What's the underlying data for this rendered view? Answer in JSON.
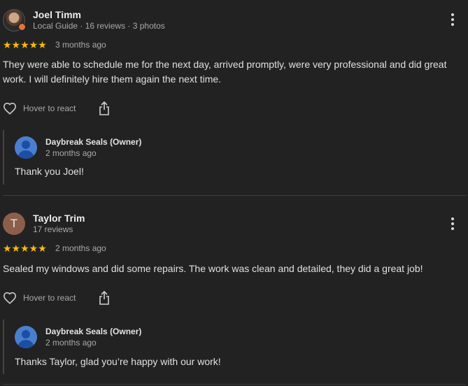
{
  "reviews": [
    {
      "reviewer": "Joel Timm",
      "meta": "Local Guide · 16 reviews · 3 photos",
      "stars": "★★★★★",
      "rating": 5,
      "date": "3 months ago",
      "text": "They were able to schedule me for the next day, arrived promptly, were very professional and did great work. I will definitely hire them again the next time.",
      "react_label": "Hover to react",
      "reply": {
        "owner": "Daybreak Seals (Owner)",
        "date": "2 months ago",
        "text": "Thank you Joel!"
      }
    },
    {
      "reviewer": "Taylor Trim",
      "avatar_letter": "T",
      "meta": "17 reviews",
      "stars": "★★★★★",
      "rating": 5,
      "date": "2 months ago",
      "text": "Sealed my windows and did some repairs. The work was clean and detailed, they did a great job!",
      "react_label": "Hover to react",
      "reply": {
        "owner": "Daybreak Seals (Owner)",
        "date": "2 months ago",
        "text": "Thanks Taylor, glad you’re happy with our work!"
      }
    }
  ],
  "colors": {
    "background": "#222222",
    "star": "#fbbc04",
    "avatar_letter_bg": "#8d5e4c",
    "owner_avatar_bg": "#4a7fd0"
  },
  "icons": [
    "heart-icon",
    "share-icon",
    "more-vert-icon",
    "local-guide-badge-icon",
    "person-icon"
  ]
}
